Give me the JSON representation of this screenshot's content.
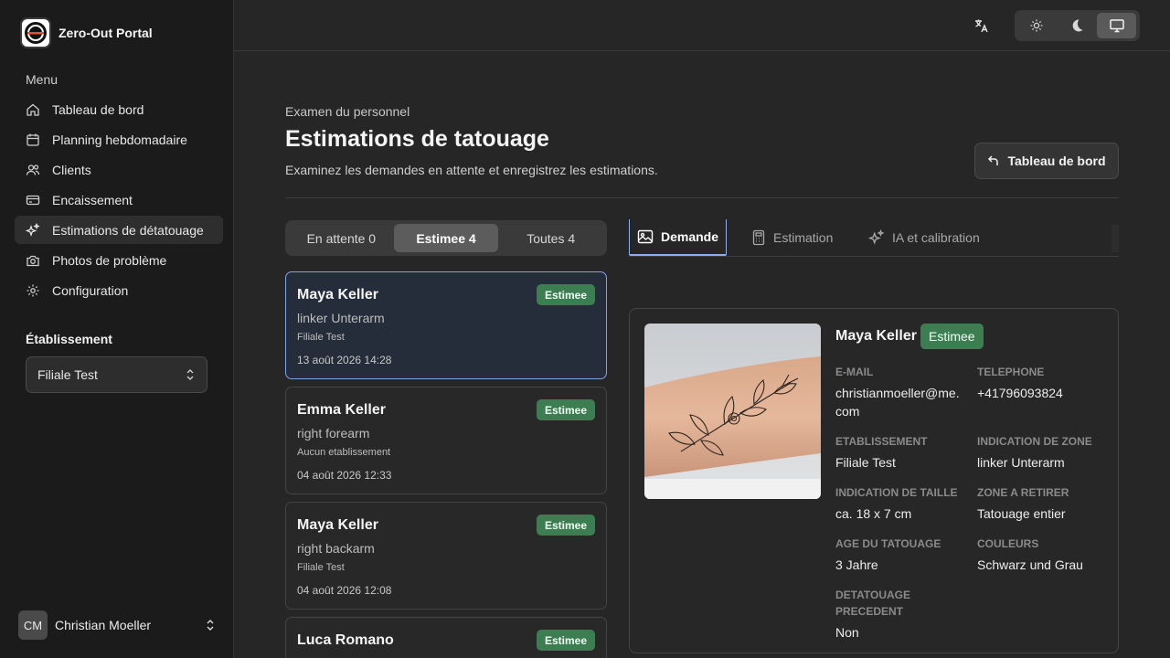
{
  "app": {
    "title": "Zero-Out Portal"
  },
  "sidebar": {
    "menu_label": "Menu",
    "items": [
      {
        "label": "Tableau de bord",
        "icon": "home-icon"
      },
      {
        "label": "Planning hebdomadaire",
        "icon": "calendar-icon"
      },
      {
        "label": "Clients",
        "icon": "users-icon"
      },
      {
        "label": "Encaissement",
        "icon": "credit-card-icon"
      },
      {
        "label": "Estimations de détatouage",
        "icon": "sparkles-icon"
      },
      {
        "label": "Photos de problème",
        "icon": "camera-icon"
      },
      {
        "label": "Configuration",
        "icon": "gear-icon"
      }
    ],
    "establishment_label": "Établissement",
    "establishment_value": "Filiale Test"
  },
  "user": {
    "initials": "CM",
    "name": "Christian Moeller"
  },
  "header": {
    "kicker": "Examen du personnel",
    "title": "Estimations de tatouage",
    "description": "Examinez les demandes en attente et enregistrez les estimations.",
    "back_button": "Tableau de bord"
  },
  "filters": [
    {
      "label": "En attente 0"
    },
    {
      "label": "Estimee 4"
    },
    {
      "label": "Toutes 4"
    }
  ],
  "cards": [
    {
      "name": "Maya Keller",
      "zone": "linker Unterarm",
      "establishment": "Filiale Test",
      "date": "13 août 2026 14:28",
      "status": "Estimee"
    },
    {
      "name": "Emma Keller",
      "zone": "right forearm",
      "establishment": "Aucun etablissement",
      "date": "04 août 2026 12:33",
      "status": "Estimee"
    },
    {
      "name": "Maya Keller",
      "zone": "right backarm",
      "establishment": "Filiale Test",
      "date": "04 août 2026 12:08",
      "status": "Estimee"
    },
    {
      "name": "Luca Romano",
      "zone": "",
      "establishment": "",
      "date": "",
      "status": "Estimee"
    }
  ],
  "detail_tabs": [
    {
      "label": "Demande",
      "icon": "image-icon"
    },
    {
      "label": "Estimation",
      "icon": "calculator-icon"
    },
    {
      "label": "IA et calibration",
      "icon": "sparkles-icon"
    }
  ],
  "detail": {
    "name": "Maya Keller",
    "status": "Estimee",
    "fields": {
      "email": {
        "label": "E-mail",
        "value": "christianmoeller@me.com"
      },
      "phone": {
        "label": "Telephone",
        "value": "+41796093824"
      },
      "establishment": {
        "label": "Etablissement",
        "value": "Filiale Test"
      },
      "zone": {
        "label": "Indication de zone",
        "value": "linker Unterarm"
      },
      "size": {
        "label": "Indication de taille",
        "value": "ca. 18 x 7 cm"
      },
      "removal": {
        "label": "Zone a retirer",
        "value": "Tatouage entier"
      },
      "age": {
        "label": "Age du tatouage",
        "value": "3 Jahre"
      },
      "colors": {
        "label": "Couleurs",
        "value": "Schwarz und Grau"
      },
      "previous": {
        "label": "Detatouage precedent",
        "value": "Non"
      }
    }
  },
  "colors": {
    "accent": "#7ea2e6",
    "badge": "#3c7d52",
    "sidebar": "#1b1b1b",
    "background": "#262626"
  }
}
